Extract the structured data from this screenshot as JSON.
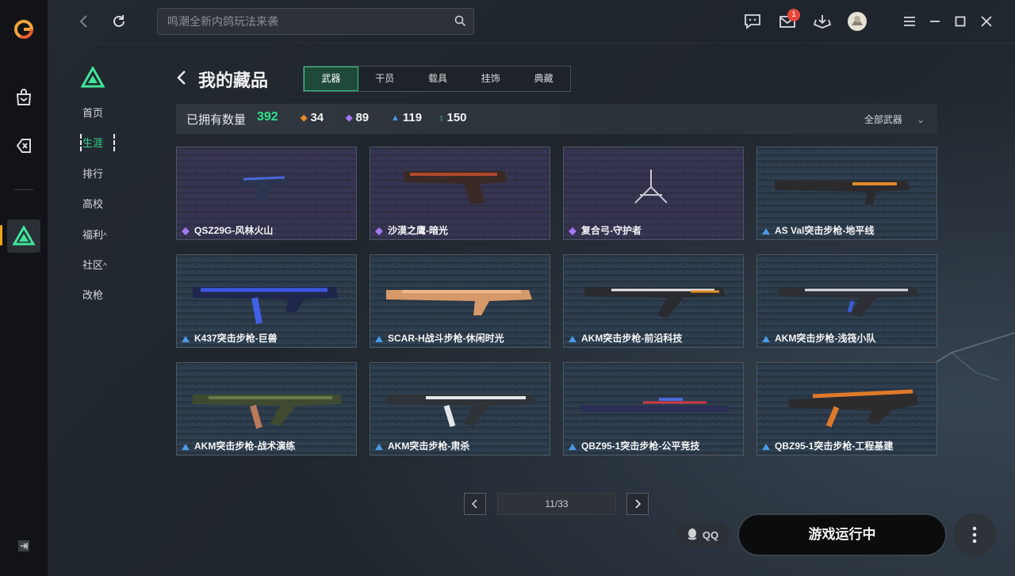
{
  "window": {
    "search_placeholder": "鸣潮全新内鸽玩法来袭",
    "mail_badge": "1"
  },
  "subnav": {
    "items": [
      "首页",
      "生涯",
      "排行",
      "高校",
      "福利",
      "社区",
      "改枪"
    ],
    "active_index": 1,
    "caret": "^"
  },
  "header": {
    "title": "我的藏品",
    "tabs": [
      "武器",
      "干员",
      "载具",
      "挂饰",
      "典藏"
    ],
    "active_tab": 0
  },
  "stats": {
    "owned_label": "已拥有数量",
    "total": "392",
    "counts": [
      {
        "value": "34",
        "color": "#e8862a",
        "symbol": "◆"
      },
      {
        "value": "89",
        "color": "#a677f2",
        "symbol": "◆"
      },
      {
        "value": "119",
        "color": "#4a9be6",
        "symbol": "▲"
      },
      {
        "value": "150",
        "color": "#3bd27f",
        "symbol": "↕"
      }
    ],
    "filter_label": "全部武器"
  },
  "colors": {
    "accent": "#36d48f",
    "epic": "#a677f2",
    "rare": "#4a9be6"
  },
  "items": [
    {
      "name": "QSZ29G-风林火山",
      "rarity": "epic"
    },
    {
      "name": "沙漠之鹰-暗光",
      "rarity": "epic"
    },
    {
      "name": "复合弓-守护者",
      "rarity": "epic"
    },
    {
      "name": "AS Val突击步枪-地平线",
      "rarity": "rare"
    },
    {
      "name": "K437突击步枪-巨兽",
      "rarity": "rare"
    },
    {
      "name": "SCAR-H战斗步枪-休闲时光",
      "rarity": "rare"
    },
    {
      "name": "AKM突击步枪-前沿科技",
      "rarity": "rare"
    },
    {
      "name": "AKM突击步枪-浅筏小队",
      "rarity": "rare"
    },
    {
      "name": "AKM突击步枪-战术演练",
      "rarity": "rare"
    },
    {
      "name": "AKM突击步枪-肃杀",
      "rarity": "rare"
    },
    {
      "name": "QBZ95-1突击步枪-公平竞技",
      "rarity": "rare"
    },
    {
      "name": "QBZ95-1突击步枪-工程基建",
      "rarity": "rare"
    }
  ],
  "pagination": {
    "current": 11,
    "total": 33,
    "label": "11/33"
  },
  "footer": {
    "qq_label": "QQ",
    "launch_label": "游戏运行中"
  }
}
